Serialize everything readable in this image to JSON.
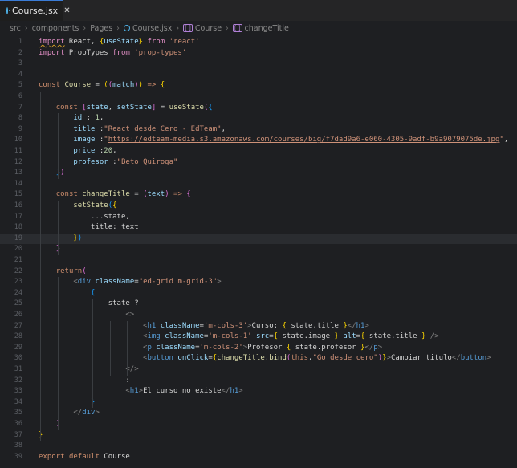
{
  "tab": {
    "label": "Course.jsx",
    "close": "✕"
  },
  "breadcrumb": [
    "src",
    "components",
    "Pages",
    "Course.jsx",
    "Course",
    "changeTitle"
  ],
  "editor": {
    "current_line": 19,
    "lines": [
      {
        "n": "1",
        "t": [
          [
            "t-imp squig",
            "import"
          ],
          [
            "t-txt",
            " React, "
          ],
          [
            "t-br1",
            "{"
          ],
          [
            "t-var",
            "useState"
          ],
          [
            "t-br1",
            "}"
          ],
          [
            "t-txt",
            " "
          ],
          [
            "t-imp",
            "from"
          ],
          [
            "t-txt",
            " "
          ],
          [
            "t-str",
            "'react'"
          ]
        ]
      },
      {
        "n": "2",
        "t": [
          [
            "t-imp",
            "import"
          ],
          [
            "t-txt",
            " PropTypes "
          ],
          [
            "t-imp",
            "from"
          ],
          [
            "t-txt",
            " "
          ],
          [
            "t-str",
            "'prop-types'"
          ]
        ]
      },
      {
        "n": "3",
        "t": []
      },
      {
        "n": "4",
        "t": []
      },
      {
        "n": "5",
        "t": [
          [
            "t-kw",
            "const"
          ],
          [
            "t-txt",
            " "
          ],
          [
            "t-fn",
            "Course"
          ],
          [
            "t-txt",
            " = "
          ],
          [
            "t-br1",
            "("
          ],
          [
            "t-br2",
            "("
          ],
          [
            "t-var",
            "match"
          ],
          [
            "t-br2",
            ")"
          ],
          [
            "t-br1",
            ")"
          ],
          [
            "t-txt",
            " "
          ],
          [
            "t-kw",
            "=>"
          ],
          [
            "t-txt",
            " "
          ],
          [
            "t-br1",
            "{"
          ]
        ]
      },
      {
        "n": "6",
        "t": []
      },
      {
        "n": "7",
        "t": [
          [
            "t-txt",
            "    "
          ],
          [
            "t-kw",
            "const"
          ],
          [
            "t-txt",
            " "
          ],
          [
            "t-br2",
            "["
          ],
          [
            "t-var",
            "state"
          ],
          [
            "t-txt",
            ", "
          ],
          [
            "t-var",
            "setState"
          ],
          [
            "t-br2",
            "]"
          ],
          [
            "t-txt",
            " = "
          ],
          [
            "t-fn",
            "useState"
          ],
          [
            "t-br2",
            "("
          ],
          [
            "t-br3",
            "{"
          ]
        ]
      },
      {
        "n": "8",
        "t": [
          [
            "t-txt",
            "        "
          ],
          [
            "t-prop",
            "id"
          ],
          [
            "t-txt",
            " : "
          ],
          [
            "t-num",
            "1"
          ],
          [
            "t-txt",
            ","
          ]
        ]
      },
      {
        "n": "9",
        "t": [
          [
            "t-txt",
            "        "
          ],
          [
            "t-prop",
            "title"
          ],
          [
            "t-txt",
            " :"
          ],
          [
            "t-str",
            "\"React desde Cero - EdTeam\""
          ],
          [
            "t-txt",
            ","
          ]
        ]
      },
      {
        "n": "10",
        "t": [
          [
            "t-txt",
            "        "
          ],
          [
            "t-prop",
            "image"
          ],
          [
            "t-txt",
            " :"
          ],
          [
            "t-str",
            "\""
          ],
          [
            "t-url",
            "https://edteam-media.s3.amazonaws.com/courses/big/f7dad9a6-e060-4305-9adf-b9a9079075de.jpg"
          ],
          [
            "t-str",
            "\""
          ],
          [
            "t-txt",
            ","
          ]
        ]
      },
      {
        "n": "11",
        "t": [
          [
            "t-txt",
            "        "
          ],
          [
            "t-prop",
            "price"
          ],
          [
            "t-txt",
            " :"
          ],
          [
            "t-num",
            "20"
          ],
          [
            "t-txt",
            ","
          ]
        ]
      },
      {
        "n": "12",
        "t": [
          [
            "t-txt",
            "        "
          ],
          [
            "t-prop",
            "profesor"
          ],
          [
            "t-txt",
            " :"
          ],
          [
            "t-str",
            "\"Beto Quiroga\""
          ]
        ]
      },
      {
        "n": "13",
        "t": [
          [
            "t-txt",
            "    "
          ],
          [
            "t-br3",
            "}"
          ],
          [
            "t-br2",
            ")"
          ]
        ]
      },
      {
        "n": "14",
        "t": []
      },
      {
        "n": "15",
        "t": [
          [
            "t-txt",
            "    "
          ],
          [
            "t-kw",
            "const"
          ],
          [
            "t-txt",
            " "
          ],
          [
            "t-fn",
            "changeTitle"
          ],
          [
            "t-txt",
            " = "
          ],
          [
            "t-br2",
            "("
          ],
          [
            "t-var",
            "text"
          ],
          [
            "t-br2",
            ")"
          ],
          [
            "t-txt",
            " "
          ],
          [
            "t-kw",
            "=>"
          ],
          [
            "t-txt",
            " "
          ],
          [
            "t-br2",
            "{"
          ]
        ]
      },
      {
        "n": "16",
        "t": [
          [
            "t-txt",
            "        "
          ],
          [
            "t-fn",
            "setState"
          ],
          [
            "t-br3",
            "("
          ],
          [
            "t-br1",
            "{"
          ]
        ]
      },
      {
        "n": "17",
        "t": [
          [
            "t-txt",
            "            ...state,"
          ]
        ]
      },
      {
        "n": "18",
        "t": [
          [
            "t-txt",
            "            title: text"
          ]
        ]
      },
      {
        "n": "19",
        "t": [
          [
            "t-txt",
            "        "
          ],
          [
            "t-br1",
            "}"
          ],
          [
            "t-br3",
            ")"
          ]
        ]
      },
      {
        "n": "20",
        "t": [
          [
            "t-txt",
            "    "
          ],
          [
            "t-br2",
            "}"
          ]
        ]
      },
      {
        "n": "21",
        "t": []
      },
      {
        "n": "22",
        "t": [
          [
            "t-txt",
            "    "
          ],
          [
            "t-kw",
            "return"
          ],
          [
            "t-br2",
            "("
          ]
        ]
      },
      {
        "n": "23",
        "t": [
          [
            "t-txt",
            "        "
          ],
          [
            "t-pun",
            "<"
          ],
          [
            "t-tag",
            "div"
          ],
          [
            "t-txt",
            " "
          ],
          [
            "t-attr",
            "className"
          ],
          [
            "t-txt",
            "="
          ],
          [
            "t-str",
            "\"ed-grid m-grid-3\""
          ],
          [
            "t-pun",
            ">"
          ]
        ]
      },
      {
        "n": "24",
        "t": [
          [
            "t-txt",
            "            "
          ],
          [
            "t-br3",
            "{"
          ]
        ]
      },
      {
        "n": "25",
        "t": [
          [
            "t-txt",
            "                state ?"
          ]
        ]
      },
      {
        "n": "26",
        "t": [
          [
            "t-txt",
            "                    "
          ],
          [
            "t-pun",
            "<>"
          ]
        ]
      },
      {
        "n": "27",
        "t": [
          [
            "t-txt",
            "                        "
          ],
          [
            "t-pun",
            "<"
          ],
          [
            "t-tag",
            "h1"
          ],
          [
            "t-txt",
            " "
          ],
          [
            "t-attr",
            "className"
          ],
          [
            "t-txt",
            "="
          ],
          [
            "t-str",
            "'m-cols-3'"
          ],
          [
            "t-pun",
            ">"
          ],
          [
            "t-txt",
            "Curso: "
          ],
          [
            "t-br1",
            "{"
          ],
          [
            "t-txt",
            " state.title "
          ],
          [
            "t-br1",
            "}"
          ],
          [
            "t-pun",
            "</"
          ],
          [
            "t-tag",
            "h1"
          ],
          [
            "t-pun",
            ">"
          ]
        ]
      },
      {
        "n": "28",
        "t": [
          [
            "t-txt",
            "                        "
          ],
          [
            "t-pun",
            "<"
          ],
          [
            "t-tag",
            "img"
          ],
          [
            "t-txt",
            " "
          ],
          [
            "t-attr",
            "className"
          ],
          [
            "t-txt",
            "="
          ],
          [
            "t-str",
            "'m-cols-1'"
          ],
          [
            "t-txt",
            " "
          ],
          [
            "t-attr",
            "src"
          ],
          [
            "t-txt",
            "="
          ],
          [
            "t-br1",
            "{"
          ],
          [
            "t-txt",
            " state.image "
          ],
          [
            "t-br1",
            "}"
          ],
          [
            "t-txt",
            " "
          ],
          [
            "t-attr",
            "alt"
          ],
          [
            "t-txt",
            "="
          ],
          [
            "t-br1",
            "{"
          ],
          [
            "t-txt",
            " state.title "
          ],
          [
            "t-br1",
            "}"
          ],
          [
            "t-txt",
            " "
          ],
          [
            "t-pun",
            "/>"
          ]
        ]
      },
      {
        "n": "29",
        "t": [
          [
            "t-txt",
            "                        "
          ],
          [
            "t-pun",
            "<"
          ],
          [
            "t-tag",
            "p"
          ],
          [
            "t-txt",
            " "
          ],
          [
            "t-attr",
            "className"
          ],
          [
            "t-txt",
            "="
          ],
          [
            "t-str",
            "'m-cols-2'"
          ],
          [
            "t-pun",
            ">"
          ],
          [
            "t-txt",
            "Profesor "
          ],
          [
            "t-br1",
            "{"
          ],
          [
            "t-txt",
            " state.profesor "
          ],
          [
            "t-br1",
            "}"
          ],
          [
            "t-pun",
            "</"
          ],
          [
            "t-tag",
            "p"
          ],
          [
            "t-pun",
            ">"
          ]
        ]
      },
      {
        "n": "30",
        "t": [
          [
            "t-txt",
            "                        "
          ],
          [
            "t-pun",
            "<"
          ],
          [
            "t-tag",
            "button"
          ],
          [
            "t-txt",
            " "
          ],
          [
            "t-attr",
            "onClick"
          ],
          [
            "t-txt",
            "="
          ],
          [
            "t-br1",
            "{"
          ],
          [
            "t-fn",
            "changeTitle"
          ],
          [
            "t-txt",
            "."
          ],
          [
            "t-fn",
            "bind"
          ],
          [
            "t-br2",
            "("
          ],
          [
            "t-kw",
            "this"
          ],
          [
            "t-txt",
            ","
          ],
          [
            "t-str",
            "\"Go desde cero\""
          ],
          [
            "t-br2",
            ")"
          ],
          [
            "t-br1",
            "}"
          ],
          [
            "t-pun",
            ">"
          ],
          [
            "t-txt",
            "Cambiar titulo"
          ],
          [
            "t-pun",
            "</"
          ],
          [
            "t-tag",
            "button"
          ],
          [
            "t-pun",
            ">"
          ]
        ]
      },
      {
        "n": "31",
        "t": [
          [
            "t-txt",
            "                    "
          ],
          [
            "t-pun",
            "</>"
          ]
        ]
      },
      {
        "n": "32",
        "t": [
          [
            "t-txt",
            "                    :"
          ]
        ]
      },
      {
        "n": "33",
        "t": [
          [
            "t-txt",
            "                    "
          ],
          [
            "t-pun",
            "<"
          ],
          [
            "t-tag",
            "h1"
          ],
          [
            "t-pun",
            ">"
          ],
          [
            "t-txt",
            "El curso no existe"
          ],
          [
            "t-pun",
            "</"
          ],
          [
            "t-tag",
            "h1"
          ],
          [
            "t-pun",
            ">"
          ]
        ]
      },
      {
        "n": "34",
        "t": [
          [
            "t-txt",
            "            "
          ],
          [
            "t-br3",
            "}"
          ]
        ]
      },
      {
        "n": "35",
        "t": [
          [
            "t-txt",
            "        "
          ],
          [
            "t-pun",
            "</"
          ],
          [
            "t-tag",
            "div"
          ],
          [
            "t-pun",
            ">"
          ]
        ]
      },
      {
        "n": "36",
        "t": [
          [
            "t-txt",
            "    "
          ],
          [
            "t-br2",
            ")"
          ]
        ]
      },
      {
        "n": "37",
        "t": [
          [
            "t-br1",
            "}"
          ]
        ]
      },
      {
        "n": "38",
        "t": []
      },
      {
        "n": "39",
        "t": [
          [
            "t-kw",
            "export"
          ],
          [
            "t-txt",
            " "
          ],
          [
            "t-kw",
            "default"
          ],
          [
            "t-txt",
            " Course"
          ]
        ]
      }
    ]
  }
}
